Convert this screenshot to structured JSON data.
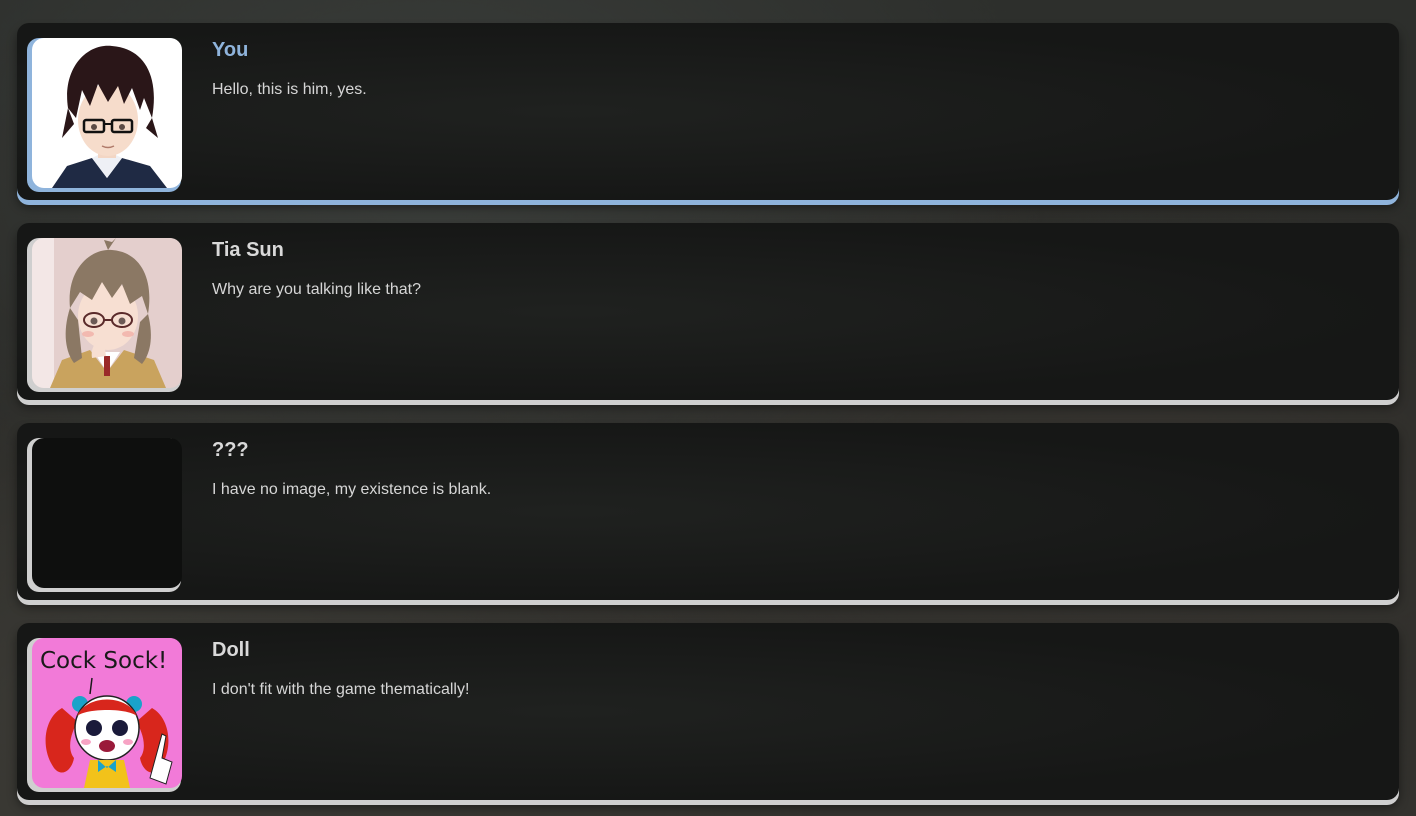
{
  "dialogue_log": [
    {
      "speaker": "You",
      "text": "Hello, this is him, yes.",
      "portrait": "dark-haired-boy-with-glasses-portrait",
      "accent": "#8fb4dc"
    },
    {
      "speaker": "Tia Sun",
      "text": "Why are you talking like that?",
      "portrait": "brown-haired-girl-with-glasses-portrait",
      "accent": "#cfcfcf"
    },
    {
      "speaker": "???",
      "text": "I have no image, my existence is blank.",
      "portrait": "blank-portrait",
      "accent": "#cfcfcf"
    },
    {
      "speaker": "Doll",
      "text": "I don't fit with the game thematically!",
      "portrait": "doll-portrait",
      "portrait_caption": "Cock Sock!",
      "accent": "#cfcfcf"
    }
  ]
}
